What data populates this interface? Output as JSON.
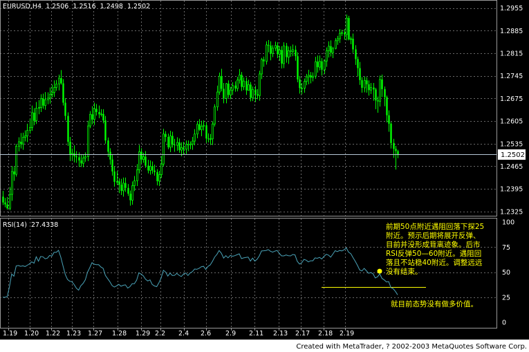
{
  "price_panel": {
    "header": "EURUSD,H4  1.2506  1.2516  1.2498  1.2502",
    "current_price_label": "1.2502"
  },
  "rsi_panel": {
    "header": "RSI(14)  27.4338"
  },
  "annotations": {
    "rsi_note_lines": [
      "前期50点附近遇阻回落下探25",
      "附近。预示后期将展开反弹、",
      "目前并没形成背离迹象。后市",
      "RSI反弹50—60附近。遇阻回",
      "落且不站稳40附近。调整远远",
      "没有结束。"
    ],
    "rsi_note_bottom": "就目前态势没有做多价值。"
  },
  "footer": "Created with MetaTrader, ? 2002-2003 MetaQuotes Software Corp.",
  "colors": {
    "background": "#000000",
    "grid": "#6a6a6a",
    "candle": "#00ff00",
    "rsi_line": "#4aa3b8",
    "annotation_text": "#ffff00",
    "annotation_marker": "#ffff00",
    "price_marker_line": "#b6c8d6"
  },
  "chart_data": [
    {
      "type": "candlestick",
      "title": "EURUSD,H4",
      "x_ticks": [
        "1.19",
        "1.20",
        "1.22",
        "1.23",
        "1.27",
        "1.28",
        "1.29",
        "2.2",
        "2.4",
        "2.6",
        "2.9",
        "2.11",
        "2.13",
        "2.17",
        "2.18",
        "2.19"
      ],
      "y_ticks": [
        "1.2955",
        "1.2885",
        "1.2815",
        "1.2745",
        "1.2675",
        "1.2605",
        "1.2535",
        "1.2465",
        "1.2395",
        "1.2325"
      ],
      "ylim": [
        1.2315,
        1.2965
      ],
      "last_price": 1.2502,
      "ohlc_open": [
        1.2371,
        1.2353,
        1.2347,
        1.2335,
        1.2378,
        1.2449,
        1.244,
        1.2527,
        1.2541,
        1.2534,
        1.2555,
        1.2559,
        1.2576,
        1.2585,
        1.2631,
        1.2606,
        1.2645,
        1.2647,
        1.2675,
        1.2653,
        1.2671,
        1.2676,
        1.2688,
        1.2694,
        1.2709,
        1.272,
        1.2738,
        1.2722,
        1.2662,
        1.2621,
        1.2541,
        1.2502,
        1.2505,
        1.2496,
        1.2493,
        1.2483,
        1.2474,
        1.2491,
        1.2495,
        1.259,
        1.2626,
        1.261,
        1.2643,
        1.2633,
        1.2626,
        1.2627,
        1.2607,
        1.2545,
        1.251,
        1.2486,
        1.2449,
        1.2417,
        1.2418,
        1.2408,
        1.2389,
        1.2413,
        1.2398,
        1.238,
        1.236,
        1.2405,
        1.242,
        1.2454,
        1.251,
        1.2486,
        1.2495,
        1.2467,
        1.2452,
        1.2465,
        1.2452,
        1.2447,
        1.2419,
        1.2439,
        1.2472,
        1.2565,
        1.2556,
        1.2524,
        1.2559,
        1.2532,
        1.253,
        1.2539,
        1.2515,
        1.2523,
        1.2518,
        1.2533,
        1.2531,
        1.2534,
        1.2543,
        1.2565,
        1.2595,
        1.2578,
        1.2589,
        1.2592,
        1.2551,
        1.2549,
        1.255,
        1.2596,
        1.2649,
        1.2695,
        1.2744,
        1.2705,
        1.2675,
        1.2721,
        1.2686,
        1.2701,
        1.2715,
        1.2706,
        1.2732,
        1.2748,
        1.2711,
        1.2729,
        1.27,
        1.2718,
        1.2677,
        1.2703,
        1.2688,
        1.2684,
        1.2751,
        1.2796,
        1.279,
        1.2841,
        1.2839,
        1.2814,
        1.2831,
        1.2839,
        1.2812,
        1.2825,
        1.2783,
        1.2838,
        1.2803,
        1.2823,
        1.282,
        1.2826,
        1.2806,
        1.2734,
        1.2707,
        1.2707,
        1.2728,
        1.2742,
        1.2747,
        1.274,
        1.2744,
        1.2789,
        1.2772,
        1.279,
        1.2764,
        1.2791,
        1.2823,
        1.2837,
        1.2817,
        1.283,
        1.2854,
        1.286,
        1.2877,
        1.2879,
        1.2873,
        1.2924,
        1.2858,
        1.286,
        1.2827,
        1.2797,
        1.2769,
        1.2732,
        1.2708,
        1.2731,
        1.2719,
        1.2701,
        1.2709,
        1.2703,
        1.2669,
        1.2666,
        1.2734,
        1.2704,
        1.2679,
        1.2623,
        1.2597,
        1.2537,
        1.2519,
        1.2512
      ],
      "ohlc_high": [
        1.2389,
        1.2367,
        1.237,
        1.2401,
        1.2466,
        1.2463,
        1.2534,
        1.2555,
        1.2568,
        1.2569,
        1.2576,
        1.2597,
        1.2612,
        1.2653,
        1.2645,
        1.2664,
        1.267,
        1.2688,
        1.269,
        1.2695,
        1.2694,
        1.2709,
        1.2718,
        1.2731,
        1.2732,
        1.2749,
        1.2763,
        1.2735,
        1.2676,
        1.2632,
        1.2556,
        1.252,
        1.253,
        1.2512,
        1.2508,
        1.25,
        1.2502,
        1.2508,
        1.2606,
        1.2636,
        1.2651,
        1.2662,
        1.2658,
        1.2653,
        1.2642,
        1.2642,
        1.2621,
        1.2554,
        1.2521,
        1.25,
        1.2464,
        1.245,
        1.2428,
        1.2426,
        1.243,
        1.243,
        1.241,
        1.239,
        1.2418,
        1.2435,
        1.2472,
        1.2531,
        1.2521,
        1.2507,
        1.2512,
        1.2485,
        1.2483,
        1.248,
        1.247,
        1.2456,
        1.2451,
        1.2497,
        1.2581,
        1.2574,
        1.2566,
        1.2575,
        1.2572,
        1.255,
        1.2555,
        1.2551,
        1.2539,
        1.2541,
        1.2545,
        1.2545,
        1.2542,
        1.2556,
        1.258,
        1.2605,
        1.2611,
        1.2606,
        1.2607,
        1.2601,
        1.2567,
        1.2565,
        1.2604,
        1.2657,
        1.2715,
        1.2755,
        1.2767,
        1.2723,
        1.2723,
        1.2731,
        1.2711,
        1.2725,
        1.2728,
        1.2742,
        1.2766,
        1.2757,
        1.274,
        1.274,
        1.2733,
        1.2726,
        1.2712,
        1.2715,
        1.2704,
        1.2761,
        1.2801,
        1.2805,
        1.2852,
        1.2856,
        1.2852,
        1.284,
        1.2851,
        1.2849,
        1.2836,
        1.2837,
        1.2849,
        1.2847,
        1.2836,
        1.2837,
        1.2842,
        1.2839,
        1.2818,
        1.2745,
        1.2723,
        1.2737,
        1.2751,
        1.2764,
        1.2757,
        1.2756,
        1.2804,
        1.2808,
        1.2808,
        1.28,
        1.2796,
        1.2833,
        1.2852,
        1.2855,
        1.2835,
        1.2862,
        1.2869,
        1.289,
        1.2888,
        1.289,
        1.2935,
        1.2931,
        1.2867,
        1.2876,
        1.284,
        1.2805,
        1.2788,
        1.2741,
        1.2743,
        1.2741,
        1.2731,
        1.2723,
        1.2723,
        1.2708,
        1.2681,
        1.2746,
        1.2749,
        1.2712,
        1.2684,
        1.2638,
        1.2602,
        1.255,
        1.2528,
        1.2516
      ],
      "ohlc_low": [
        1.2345,
        1.2338,
        1.2331,
        1.2329,
        1.2358,
        1.242,
        1.2433,
        1.2511,
        1.252,
        1.2516,
        1.2542,
        1.254,
        1.2566,
        1.2575,
        1.2592,
        1.2596,
        1.2626,
        1.2633,
        1.2643,
        1.264,
        1.2657,
        1.2659,
        1.2678,
        1.268,
        1.2699,
        1.27,
        1.2718,
        1.2653,
        1.2608,
        1.2528,
        1.2481,
        1.2484,
        1.2477,
        1.2476,
        1.2463,
        1.2463,
        1.2462,
        1.2479,
        1.2481,
        1.2583,
        1.2595,
        1.2593,
        1.2622,
        1.2614,
        1.2619,
        1.2598,
        1.2535,
        1.2494,
        1.247,
        1.2436,
        1.2402,
        1.2408,
        1.2382,
        1.2376,
        1.2371,
        1.2386,
        1.2373,
        1.2343,
        1.2346,
        1.2388,
        1.2404,
        1.2443,
        1.2474,
        1.2476,
        1.246,
        1.2443,
        1.2439,
        1.2442,
        1.2436,
        1.2406,
        1.2404,
        1.2429,
        1.2465,
        1.2541,
        1.2518,
        1.2509,
        1.2523,
        1.251,
        1.2513,
        1.2507,
        1.2496,
        1.2501,
        1.2503,
        1.2512,
        1.2518,
        1.2516,
        1.253,
        1.2552,
        1.2575,
        1.2558,
        1.2576,
        1.2538,
        1.2539,
        1.2531,
        1.2531,
        1.2588,
        1.2637,
        1.2686,
        1.2697,
        1.266,
        1.266,
        1.2677,
        1.2673,
        1.2686,
        1.2696,
        1.2697,
        1.2721,
        1.2698,
        1.2701,
        1.2686,
        1.27,
        1.2666,
        1.2667,
        1.2664,
        1.2673,
        1.2668,
        1.2735,
        1.2773,
        1.278,
        1.2818,
        1.2793,
        1.2803,
        1.2822,
        1.28,
        1.2792,
        1.2768,
        1.2769,
        1.2786,
        1.2782,
        1.2804,
        1.2806,
        1.2792,
        1.2725,
        1.269,
        1.2688,
        1.2693,
        1.2716,
        1.2719,
        1.2722,
        1.2728,
        1.2736,
        1.2755,
        1.2762,
        1.2746,
        1.2751,
        1.2773,
        1.2802,
        1.2805,
        1.28,
        1.2827,
        1.2841,
        1.2847,
        1.2869,
        1.2857,
        1.2855,
        1.2855,
        1.2843,
        1.2816,
        1.2779,
        1.2744,
        1.2717,
        1.2693,
        1.2694,
        1.2693,
        1.2684,
        1.2689,
        1.2668,
        1.2642,
        1.2631,
        1.265,
        1.268,
        1.2651,
        1.2601,
        1.2572,
        1.252,
        1.2491,
        1.2455,
        1.249
      ],
      "ohlc_close": [
        1.2353,
        1.2347,
        1.2335,
        1.2378,
        1.2449,
        1.244,
        1.2527,
        1.2541,
        1.2534,
        1.2555,
        1.2559,
        1.2576,
        1.2585,
        1.2631,
        1.2606,
        1.2645,
        1.2647,
        1.2675,
        1.2653,
        1.2671,
        1.2676,
        1.2688,
        1.2694,
        1.2709,
        1.272,
        1.2738,
        1.2722,
        1.2662,
        1.2621,
        1.2541,
        1.2502,
        1.2505,
        1.2496,
        1.2493,
        1.2483,
        1.2474,
        1.2491,
        1.2495,
        1.259,
        1.2626,
        1.261,
        1.2643,
        1.2633,
        1.2626,
        1.2627,
        1.2607,
        1.2545,
        1.251,
        1.2486,
        1.2449,
        1.2417,
        1.2418,
        1.2408,
        1.2389,
        1.2413,
        1.2398,
        1.238,
        1.236,
        1.2405,
        1.242,
        1.2454,
        1.251,
        1.2486,
        1.2495,
        1.2467,
        1.2452,
        1.2465,
        1.2452,
        1.2447,
        1.2419,
        1.2439,
        1.2472,
        1.2565,
        1.2556,
        1.2524,
        1.2559,
        1.2532,
        1.253,
        1.2539,
        1.2515,
        1.2523,
        1.2518,
        1.2533,
        1.2531,
        1.2534,
        1.2543,
        1.2565,
        1.2595,
        1.2578,
        1.2589,
        1.2592,
        1.2551,
        1.2549,
        1.255,
        1.2596,
        1.2649,
        1.2695,
        1.2744,
        1.2705,
        1.2675,
        1.2721,
        1.2686,
        1.2701,
        1.2715,
        1.2706,
        1.2732,
        1.2748,
        1.2711,
        1.2729,
        1.27,
        1.2718,
        1.2677,
        1.2703,
        1.2688,
        1.2684,
        1.2751,
        1.2796,
        1.279,
        1.2841,
        1.2839,
        1.2814,
        1.2831,
        1.2839,
        1.2812,
        1.2825,
        1.2783,
        1.2838,
        1.2803,
        1.2823,
        1.282,
        1.2826,
        1.2806,
        1.2734,
        1.2707,
        1.2707,
        1.2728,
        1.2742,
        1.2747,
        1.274,
        1.2744,
        1.2789,
        1.2772,
        1.279,
        1.2764,
        1.2791,
        1.2823,
        1.2837,
        1.2817,
        1.283,
        1.2854,
        1.286,
        1.2877,
        1.2879,
        1.2873,
        1.2924,
        1.2858,
        1.286,
        1.2827,
        1.2797,
        1.2769,
        1.2732,
        1.2708,
        1.2731,
        1.2719,
        1.2701,
        1.2709,
        1.2703,
        1.2669,
        1.2666,
        1.2734,
        1.2704,
        1.2679,
        1.2623,
        1.2597,
        1.2537,
        1.2519,
        1.2512,
        1.2502
      ]
    },
    {
      "type": "line",
      "title": "RSI(14)",
      "x_ticks": [
        "1.19",
        "1.20",
        "1.22",
        "1.23",
        "1.27",
        "1.28",
        "1.29",
        "2.2",
        "2.4",
        "2.6",
        "2.9",
        "2.11",
        "2.13",
        "2.17",
        "2.18",
        "2.19"
      ],
      "y_ticks": [
        "100",
        "75",
        "50",
        "25",
        "0"
      ],
      "ylim": [
        0,
        100
      ],
      "current_value": 27.4338,
      "reference_level": 35,
      "marker_value": 51,
      "series": [
        {
          "name": "RSI(14)",
          "values": [
            25.0,
            24.9,
            25.6,
            35.5,
            48.1,
            45.9,
            56.2,
            56.6,
            55.8,
            56.3,
            55.6,
            56.9,
            58.3,
            60.3,
            58.9,
            65.3,
            60.9,
            65.6,
            65.3,
            63.3,
            63.9,
            66.6,
            66.0,
            69.7,
            69.7,
            71.7,
            65.0,
            56.3,
            47.8,
            42.7,
            40.9,
            40.5,
            37.6,
            33.9,
            32.0,
            36.4,
            38.7,
            42.4,
            49.9,
            54.4,
            59.4,
            57.9,
            57.4,
            57.4,
            55.1,
            53.7,
            46.7,
            43.6,
            40.5,
            36.6,
            35.1,
            36.3,
            37.8,
            35.9,
            36.9,
            37.3,
            34.1,
            35.5,
            38.5,
            38.4,
            41.9,
            49.3,
            48.1,
            46.3,
            42.9,
            41.2,
            42.3,
            37.7,
            36.2,
            35.5,
            39.4,
            44.1,
            51.8,
            50.1,
            46.1,
            49.0,
            46.6,
            46.8,
            48.7,
            46.9,
            45.6,
            48.0,
            49.2,
            46.6,
            49.2,
            50.5,
            53.1,
            52.8,
            53.8,
            55.4,
            55.8,
            52.6,
            55.7,
            57.2,
            60.7,
            65.1,
            67.7,
            71.5,
            68.8,
            64.0,
            66.4,
            64.3,
            66.7,
            65.8,
            66.4,
            67.3,
            68.3,
            63.5,
            64.2,
            64.6,
            65.0,
            61.0,
            64.0,
            61.0,
            62.8,
            66.2,
            71.1,
            71.3,
            71.6,
            72.5,
            70.8,
            69.9,
            71.0,
            71.6,
            68.6,
            66.2,
            66.2,
            67.1,
            66.4,
            66.2,
            67.6,
            67.2,
            60.9,
            58.1,
            59.3,
            62.7,
            61.9,
            60.2,
            61.3,
            61.3,
            64.2,
            63.8,
            64.7,
            63.1,
            65.7,
            67.8,
            67.0,
            64.9,
            68.0,
            71.4,
            70.5,
            71.6,
            71.2,
            72.3,
            74.2,
            70.0,
            68.4,
            64.5,
            60.8,
            56.8,
            52.1,
            51.2,
            53.7,
            51.4,
            48.8,
            49.6,
            48.3,
            44.2,
            45.4,
            48.3,
            43.7,
            42.3,
            40.2,
            40.5,
            34.6,
            33.5,
            30.8,
            27.4
          ]
        }
      ]
    }
  ]
}
